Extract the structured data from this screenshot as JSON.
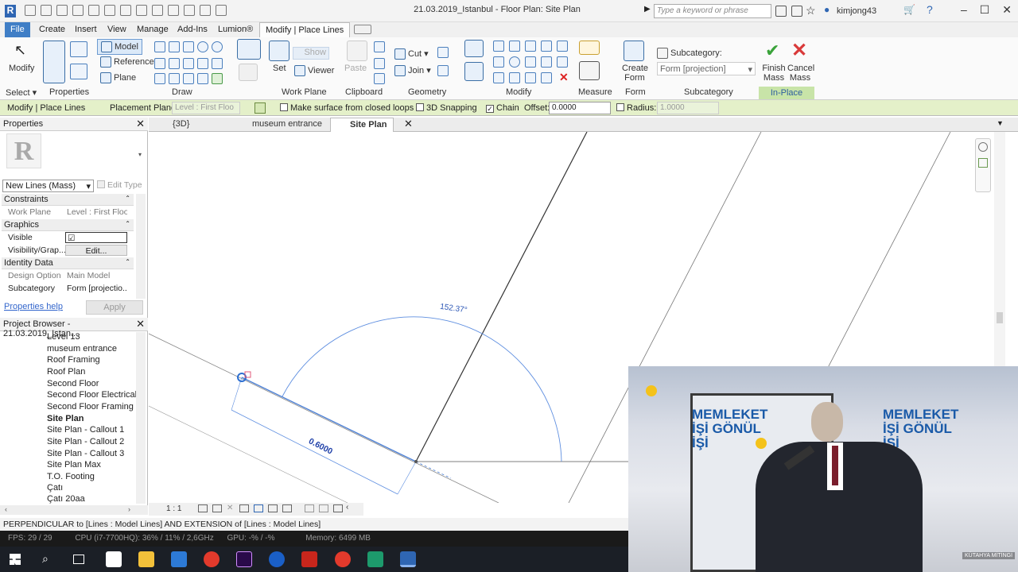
{
  "app": {
    "title": "21.03.2019_Istanbul - Floor Plan: Site Plan",
    "search_placeholder": "Type a keyword or phrase",
    "user": "kimjong43"
  },
  "tabs": [
    "File",
    "Create",
    "Insert",
    "View",
    "Manage",
    "Add-Ins",
    "Lumion®",
    "Modify | Place Lines"
  ],
  "ribbon": {
    "select": {
      "label": "Select",
      "modify": "Modify"
    },
    "properties": {
      "label": "Properties"
    },
    "draw": {
      "label": "Draw",
      "model": "Model",
      "reference": "Reference",
      "plane": "Plane"
    },
    "work_plane": {
      "label": "Work Plane",
      "set": "Set",
      "show": "Show",
      "viewer": "Viewer"
    },
    "clipboard": {
      "label": "Clipboard",
      "paste": "Paste"
    },
    "geometry": {
      "label": "Geometry",
      "cut": "Cut",
      "join": "Join"
    },
    "modify": {
      "label": "Modify"
    },
    "measure": {
      "label": "Measure"
    },
    "form": {
      "label": "Form",
      "create_form": "Create Form"
    },
    "subcategory": {
      "label": "Subcategory",
      "title": "Subcategory:",
      "value": "Form [projection]"
    },
    "in_place": {
      "label": "In-Place Editor",
      "finish": "Finish Mass",
      "cancel": "Cancel Mass"
    }
  },
  "options_bar": {
    "context": "Modify | Place Lines",
    "placement_plane_label": "Placement Plane:",
    "placement_plane_value": "Level : First Floo",
    "make_surface": "Make surface from closed loops",
    "snapping_3d": "3D Snapping",
    "chain": "Chain",
    "offset_label": "Offset:",
    "offset_value": "0.0000",
    "radius_label": "Radius:",
    "radius_value": "1.0000"
  },
  "properties": {
    "header": "Properties",
    "type": "New Lines (Mass)",
    "edit_type": "Edit Type",
    "sections": {
      "constraints": "Constraints",
      "graphics": "Graphics",
      "identity": "Identity Data"
    },
    "rows": {
      "work_plane": {
        "label": "Work Plane",
        "value": "Level : First Floor"
      },
      "visible": {
        "label": "Visible",
        "value": "☑"
      },
      "visibility": {
        "label": "Visibility/Grap...",
        "value": "Edit..."
      },
      "design_option": {
        "label": "Design Option",
        "value": "Main Model"
      },
      "subcategory": {
        "label": "Subcategory",
        "value": "Form [projectio..."
      }
    },
    "help": "Properties help",
    "apply": "Apply"
  },
  "browser": {
    "header": "Project Browser - 21.03.2019_Istan...",
    "items": [
      "Level 13",
      "museum entrance",
      "Roof Framing",
      "Roof Plan",
      "Second Floor",
      "Second Floor Electrical",
      "Second Floor Framing",
      "Site Plan",
      "Site Plan - Callout 1",
      "Site Plan - Callout 2",
      "Site Plan - Callout 3",
      "Site Plan Max",
      "T.O. Footing",
      "Çatı",
      "Çatı 20aa"
    ],
    "selected": "Site Plan"
  },
  "view_tabs": [
    "{3D}",
    "museum entrance",
    "Site Plan"
  ],
  "canvas": {
    "angle_label": "152.37°",
    "dimension_label": "0.6000"
  },
  "view_control": {
    "scale": "1 : 1"
  },
  "status_bar": "PERPENDICULAR  to [Lines : Model Lines] AND EXTENSION  of [Lines : Model Lines]",
  "perf": {
    "fps": "FPS: 29 / 29",
    "cpu": "CPU (i7-7700HQ):  36% / 11% / 2,6GHz",
    "gpu": "GPU:  -% / -%",
    "memory": "Memory:  6499 MB"
  },
  "video": {
    "banner_text": "MEMLEKET İŞİ GÖNÜL İŞİ",
    "caption": "KÜTAHYA MİTİNGİ"
  },
  "colors": {
    "file_tab": "#3f7ec6",
    "options_bar": "#e4f0c9",
    "in_place_editor": "#c8e4a8",
    "sketch_blue": "#4a7fd6",
    "finish_green": "#3aa33a",
    "cancel_red": "#d93a3a"
  }
}
